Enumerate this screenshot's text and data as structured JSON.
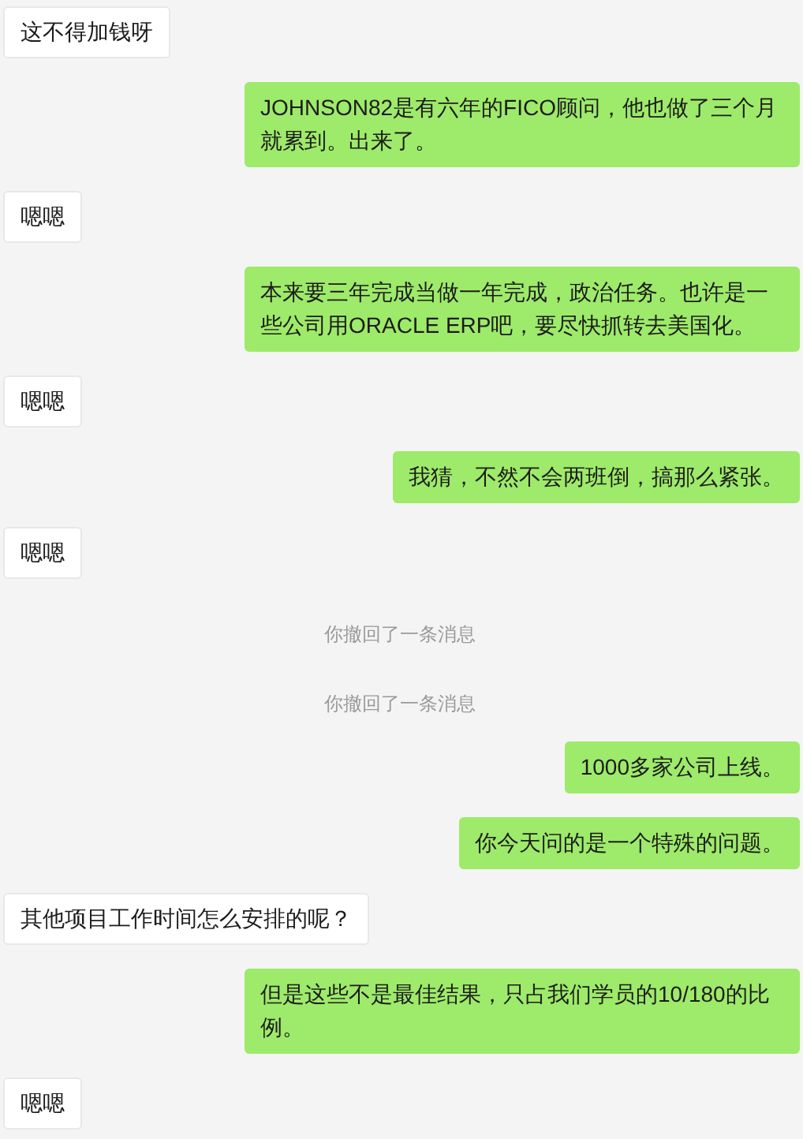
{
  "messages": [
    {
      "kind": "received",
      "text": "这不得加钱呀"
    },
    {
      "kind": "sent",
      "text": "JOHNSON82是有六年的FICO顾问，他也做了三个月就累到。出来了。"
    },
    {
      "kind": "received",
      "text": "嗯嗯"
    },
    {
      "kind": "sent",
      "text": "本来要三年完成当做一年完成，政治任务。也许是一些公司用ORACLE ERP吧，要尽快抓转去美国化。"
    },
    {
      "kind": "received",
      "text": "嗯嗯"
    },
    {
      "kind": "sent",
      "text": "我猜，不然不会两班倒，搞那么紧张。"
    },
    {
      "kind": "received",
      "text": "嗯嗯"
    },
    {
      "kind": "system",
      "text": "你撤回了一条消息"
    },
    {
      "kind": "system",
      "text": "你撤回了一条消息"
    },
    {
      "kind": "sent",
      "text": "1000多家公司上线。"
    },
    {
      "kind": "sent",
      "text": "你今天问的是一个特殊的问题。"
    },
    {
      "kind": "received",
      "text": "其他项目工作时间怎么安排的呢？"
    },
    {
      "kind": "sent",
      "text": "但是这些不是最佳结果，只占我们学员的10/180的比例。"
    },
    {
      "kind": "received",
      "text": "嗯嗯"
    }
  ]
}
